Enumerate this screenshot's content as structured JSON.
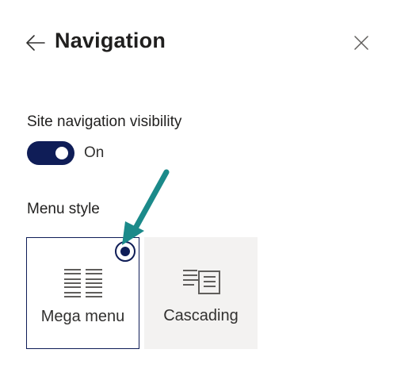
{
  "header": {
    "title": "Navigation",
    "back_icon": "arrow-left-icon",
    "close_icon": "close-icon"
  },
  "site_navigation": {
    "label": "Site navigation visibility",
    "toggle_state": "On",
    "toggle_on": true
  },
  "menu_style": {
    "label": "Menu style",
    "options": [
      {
        "label": "Mega menu",
        "icon": "mega-menu-icon",
        "selected": true
      },
      {
        "label": "Cascading",
        "icon": "cascading-menu-icon",
        "selected": false
      }
    ]
  },
  "colors": {
    "accent": "#0f1d57",
    "annotation_arrow": "#1b8a8a",
    "card_unselected_bg": "#f3f2f1",
    "text": "#201f1e"
  }
}
